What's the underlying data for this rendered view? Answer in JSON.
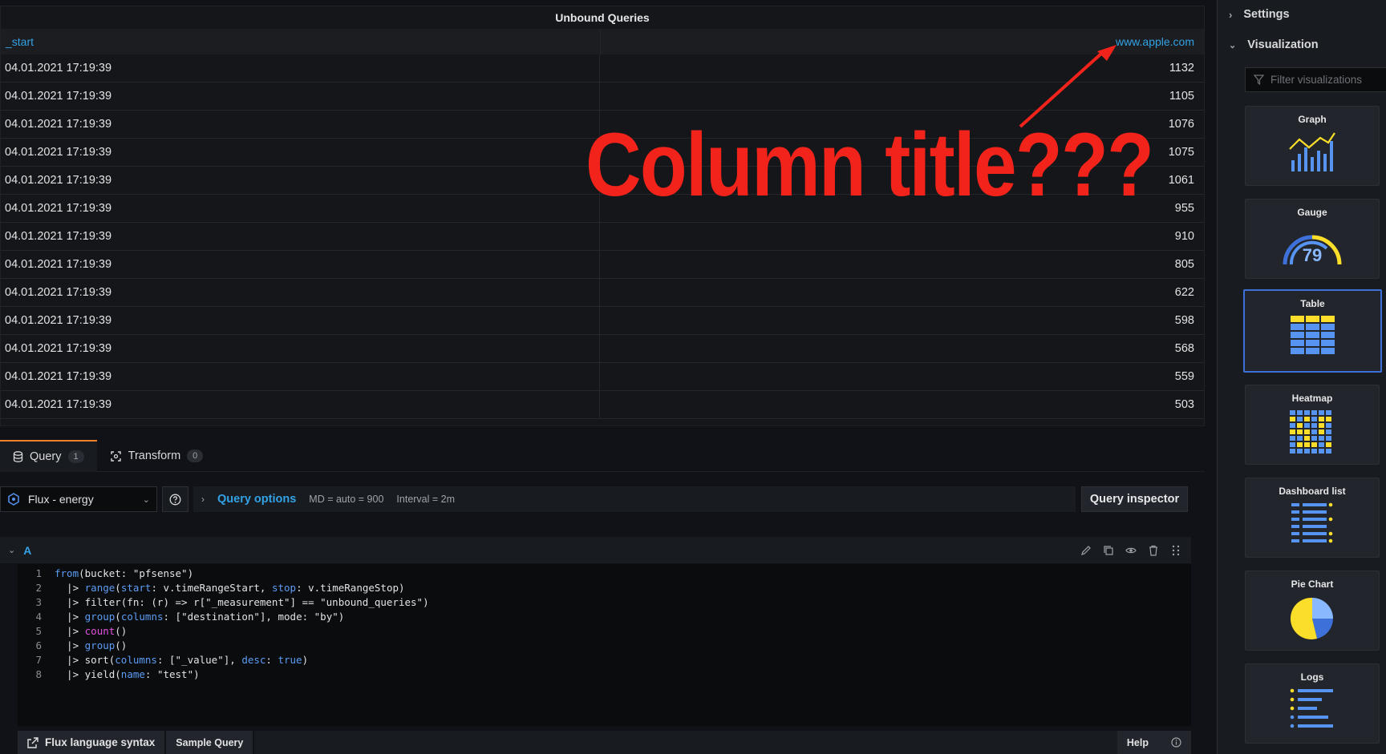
{
  "panel": {
    "title": "Unbound Queries",
    "columns": [
      "_start",
      "www.apple.com"
    ],
    "rows": [
      [
        "04.01.2021 17:19:39",
        "1132"
      ],
      [
        "04.01.2021 17:19:39",
        "1105"
      ],
      [
        "04.01.2021 17:19:39",
        "1076"
      ],
      [
        "04.01.2021 17:19:39",
        "1075"
      ],
      [
        "04.01.2021 17:19:39",
        "1061"
      ],
      [
        "04.01.2021 17:19:39",
        "955"
      ],
      [
        "04.01.2021 17:19:39",
        "910"
      ],
      [
        "04.01.2021 17:19:39",
        "805"
      ],
      [
        "04.01.2021 17:19:39",
        "622"
      ],
      [
        "04.01.2021 17:19:39",
        "598"
      ],
      [
        "04.01.2021 17:19:39",
        "568"
      ],
      [
        "04.01.2021 17:19:39",
        "559"
      ],
      [
        "04.01.2021 17:19:39",
        "503"
      ]
    ]
  },
  "annotation": {
    "text": "Column title???",
    "color": "#f2231a"
  },
  "tabs": {
    "query": {
      "label": "Query",
      "count": "1"
    },
    "transform": {
      "label": "Transform",
      "count": "0"
    }
  },
  "query_bar": {
    "datasource": "Flux - energy",
    "options_label": "Query options",
    "md": "MD = auto = 900",
    "interval": "Interval = 2m",
    "inspector": "Query inspector"
  },
  "query_row": {
    "letter": "A"
  },
  "code_lines": [
    {
      "n": "1",
      "parts": [
        [
          "kw",
          "from"
        ],
        [
          "",
          "(bucket: \"pfsense\")"
        ]
      ]
    },
    {
      "n": "2",
      "parts": [
        [
          "",
          "  |> "
        ],
        [
          "kw",
          "range"
        ],
        [
          "",
          "("
        ],
        [
          "kw",
          "start"
        ],
        [
          "",
          ": v.timeRangeStart, "
        ],
        [
          "kw",
          "stop"
        ],
        [
          "",
          ": v.timeRangeStop)"
        ]
      ]
    },
    {
      "n": "3",
      "parts": [
        [
          "",
          "  |> filter(fn: (r) => r[\"_measurement\"] == \"unbound_queries\")"
        ]
      ]
    },
    {
      "n": "4",
      "parts": [
        [
          "",
          "  |> "
        ],
        [
          "kw",
          "group"
        ],
        [
          "",
          "("
        ],
        [
          "kw",
          "columns"
        ],
        [
          "",
          ": [\"destination\"], mode: \"by\")"
        ]
      ]
    },
    {
      "n": "5",
      "parts": [
        [
          "",
          "  |> "
        ],
        [
          "pk",
          "count"
        ],
        [
          "",
          "()"
        ]
      ]
    },
    {
      "n": "6",
      "parts": [
        [
          "",
          "  |> "
        ],
        [
          "kw",
          "group"
        ],
        [
          "",
          "()"
        ]
      ]
    },
    {
      "n": "7",
      "parts": [
        [
          "",
          "  |> sort("
        ],
        [
          "kw",
          "columns"
        ],
        [
          "",
          ": [\"_value\"], "
        ],
        [
          "kw",
          "desc"
        ],
        [
          "",
          ": "
        ],
        [
          "kw",
          "true"
        ],
        [
          "",
          ")"
        ]
      ]
    },
    {
      "n": "8",
      "parts": [
        [
          "",
          "  |> yield("
        ],
        [
          "kw",
          "name"
        ],
        [
          "",
          ": \"test\")"
        ]
      ]
    }
  ],
  "bottom_bar": {
    "syntax": "Flux language syntax",
    "sample": "Sample Query",
    "help": "Help"
  },
  "sidebar": {
    "settings": "Settings",
    "visualization": "Visualization",
    "filter_placeholder": "Filter visualizations",
    "cards": [
      "Graph",
      "Gauge",
      "Table",
      "Heatmap",
      "Dashboard list",
      "Pie Chart",
      "Logs"
    ],
    "selected": "Table",
    "gauge_value": "79"
  },
  "colors": {
    "accent": "#33a2e5",
    "blue": "#5794f2",
    "yellow": "#fade2a",
    "orange": "#f5822a",
    "selected": "#3d71d9"
  }
}
